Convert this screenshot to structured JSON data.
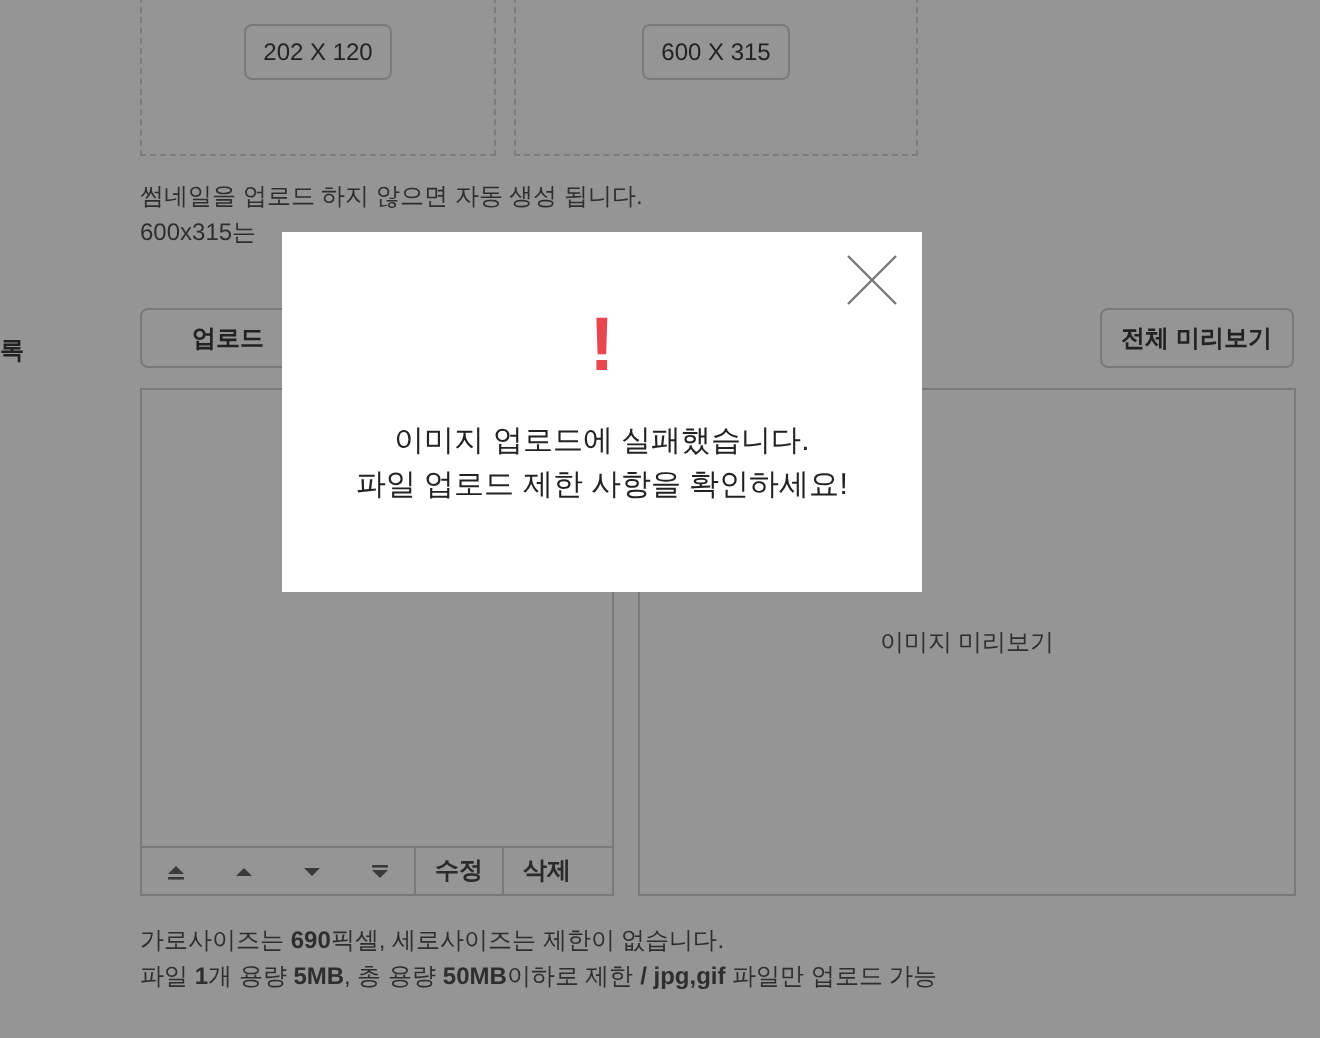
{
  "thumbnails": [
    {
      "size": "202 X 120"
    },
    {
      "size": "600 X 315"
    }
  ],
  "thumbnail_notes": [
    "썸네일을 업로드 하지 않으면 자동 생성 됩니다.",
    "600x315는"
  ],
  "section_label": "록",
  "upload_button": "업로드",
  "preview_all_button": "전체 미리보기",
  "list_toolbar": {
    "moves": [
      {
        "kind": "top"
      },
      {
        "kind": "up"
      },
      {
        "kind": "down"
      },
      {
        "kind": "bottom"
      }
    ],
    "buttons": [
      "수정",
      "삭제"
    ]
  },
  "preview_placeholder": "이미지 미리보기",
  "upload_notes": [
    "가로사이즈는 **690**픽셀, 세로사이즈는 제한이 없습니다.",
    "파일 **1**개 용량 **5MB**, 총 용량 **50MB**이하로 제한 **/ jpg,gif** 파일만 업로드 가능"
  ],
  "dialog": {
    "icon": "!",
    "lines": [
      "이미지 업로드에 실패했습니다.",
      "파일 업로드 제한 사항을 확인하세요!"
    ]
  }
}
